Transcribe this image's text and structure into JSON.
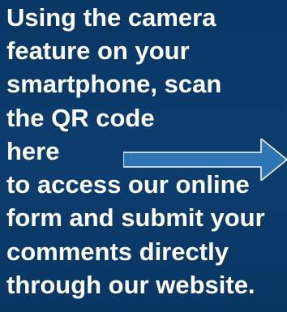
{
  "instruction_lines": [
    "Using the camera",
    "feature on your",
    "smartphone, scan",
    "the QR code",
    "here",
    "to access our online",
    "form and submit your",
    "comments directly",
    "through our website."
  ],
  "colors": {
    "background": "#0b3a68",
    "text": "#ffffff",
    "arrow": "#2e75b6"
  },
  "icons": {
    "arrow": "arrow-right-icon"
  }
}
